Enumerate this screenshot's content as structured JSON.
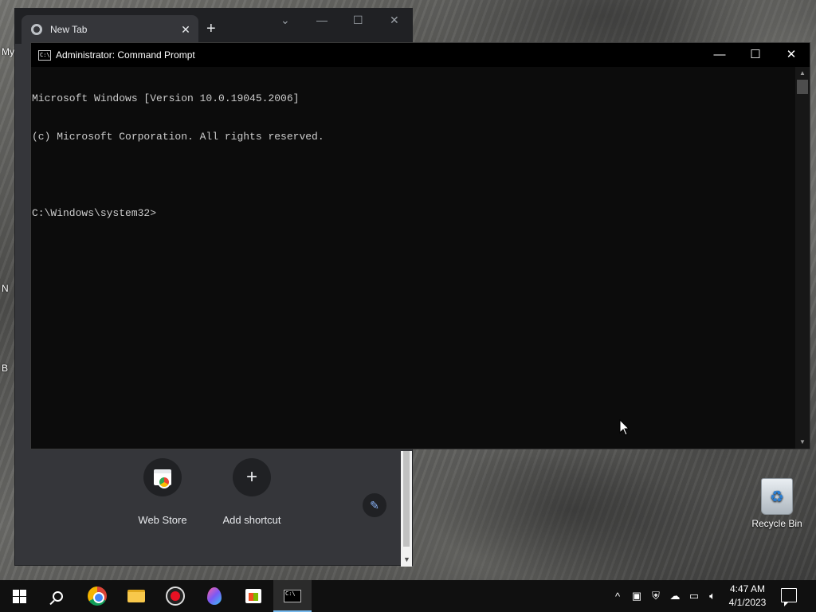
{
  "desktop": {
    "edge_labels": [
      "My",
      "N",
      "B"
    ],
    "recycle_bin_label": "Recycle Bin"
  },
  "chrome": {
    "tab_title": "New Tab",
    "tab_close": "✕",
    "new_tab": "+",
    "minimize": "—",
    "maximize": "☐",
    "close": "✕",
    "chevron": "⌄",
    "shortcuts": [
      {
        "label": "Web Store",
        "icon": "web-store-icon"
      },
      {
        "label": "Add shortcut",
        "icon": "plus-icon",
        "glyph": "+"
      }
    ],
    "edit_icon": "✎"
  },
  "cmd": {
    "title": "Administrator: Command Prompt",
    "lines": [
      "Microsoft Windows [Version 10.0.19045.2006]",
      "(c) Microsoft Corporation. All rights reserved.",
      "",
      "C:\\Windows\\system32>"
    ],
    "minimize": "—",
    "maximize": "☐",
    "close": "✕"
  },
  "taskbar": {
    "apps": [
      "start-icon",
      "search-icon",
      "chrome-icon",
      "file-explorer-icon",
      "screen-recorder-icon",
      "paint-icon",
      "microsoft-store-icon",
      "command-prompt-icon"
    ],
    "active_app": "command-prompt-icon",
    "clock_time": "4:47 AM",
    "clock_date": "4/1/2023",
    "tray_overflow": "^"
  },
  "colors": {
    "cmd_bg": "#0c0c0c",
    "cmd_text": "#cccccc",
    "chrome_bg": "#35363a",
    "taskbar_bg": "#101010",
    "accent": "#76b9ed"
  }
}
